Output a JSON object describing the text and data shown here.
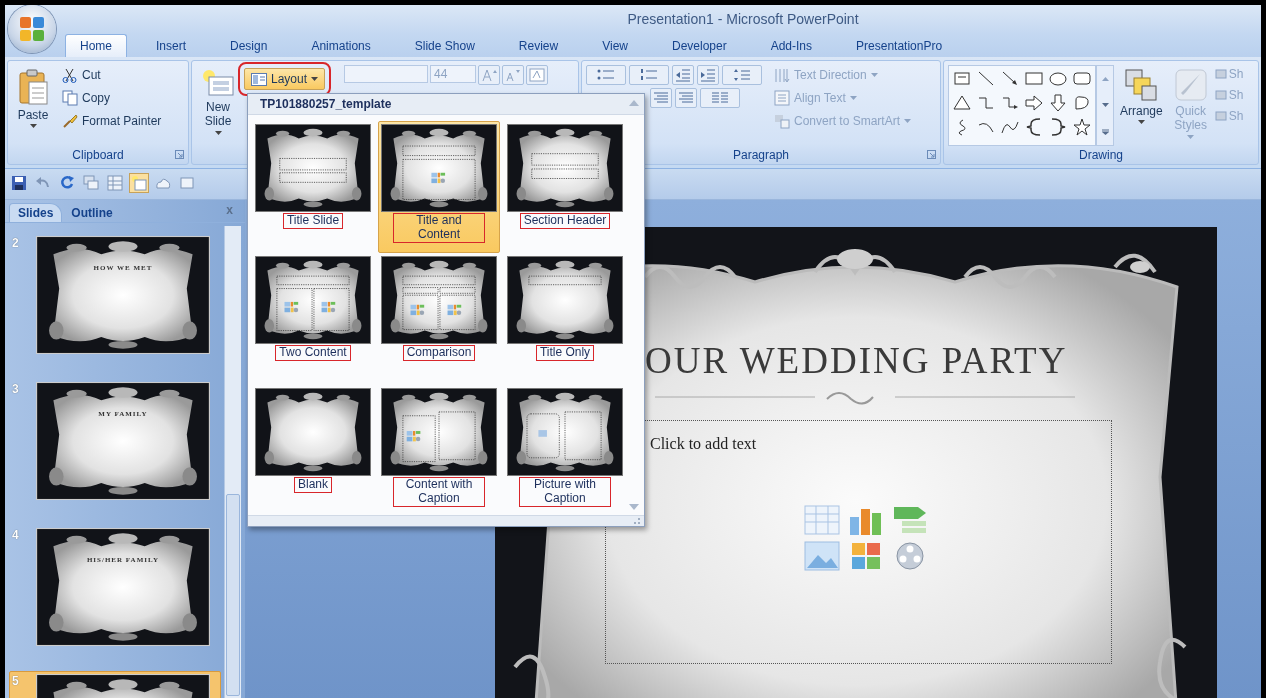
{
  "window": {
    "title": "Presentation1 - Microsoft PowerPoint"
  },
  "ribbon_tabs": [
    {
      "label": "Home",
      "selected": true
    },
    {
      "label": "Insert",
      "selected": false
    },
    {
      "label": "Design",
      "selected": false
    },
    {
      "label": "Animations",
      "selected": false
    },
    {
      "label": "Slide Show",
      "selected": false
    },
    {
      "label": "Review",
      "selected": false
    },
    {
      "label": "View",
      "selected": false
    },
    {
      "label": "Developer",
      "selected": false
    },
    {
      "label": "Add-Ins",
      "selected": false
    },
    {
      "label": "PresentationPro",
      "selected": false
    }
  ],
  "clipboard": {
    "paste": "Paste",
    "items": [
      "Cut",
      "Copy",
      "Format Painter"
    ],
    "label": "Clipboard"
  },
  "slides_group": {
    "new_slide": "New Slide",
    "layout_button": {
      "label": "Layout",
      "expanded": true
    }
  },
  "font_group": {
    "size": "44",
    "disabled": true
  },
  "paragraph": {
    "items": [
      {
        "label": "Text Direction",
        "disabled": true
      },
      {
        "label": "Align Text",
        "disabled": true
      },
      {
        "label": "Convert to SmartArt",
        "disabled": true
      }
    ],
    "label": "Paragraph"
  },
  "drawing": {
    "arrange": {
      "label": "Arrange",
      "disabled": false
    },
    "quick_styles": {
      "label": "Quick Styles",
      "disabled": true
    },
    "shape_items": [
      {
        "label": "Sh",
        "disabled": true
      },
      {
        "label": "Sh",
        "disabled": true
      },
      {
        "label": "Sh",
        "disabled": true
      }
    ],
    "label": "Drawing"
  },
  "layout_gallery": {
    "title": "TP101880257_template",
    "layouts": [
      {
        "label": "Title Slide",
        "kind": "title",
        "selected": false
      },
      {
        "label": "Title and Content",
        "kind": "title_content",
        "selected": true
      },
      {
        "label": "Section Header",
        "kind": "section",
        "selected": false
      },
      {
        "label": "Two Content",
        "kind": "two_content",
        "selected": false
      },
      {
        "label": "Comparison",
        "kind": "comparison",
        "selected": false
      },
      {
        "label": "Title Only",
        "kind": "title_only",
        "selected": false
      },
      {
        "label": "Blank",
        "kind": "blank",
        "selected": false
      },
      {
        "label": "Content with Caption",
        "kind": "content_caption",
        "selected": false
      },
      {
        "label": "Picture with Caption",
        "kind": "picture_caption",
        "selected": false
      }
    ]
  },
  "slide_pane": {
    "tabs": [
      {
        "label": "Slides",
        "selected": true
      },
      {
        "label": "Outline",
        "selected": false
      }
    ],
    "close": "x",
    "slides": [
      {
        "number": "2",
        "title": "HOW WE MET",
        "selected": false
      },
      {
        "number": "3",
        "title": "MY FAMILY",
        "selected": false
      },
      {
        "number": "4",
        "title": "HIS/HER FAMILY",
        "selected": false
      },
      {
        "number": "5",
        "selected": true
      }
    ]
  },
  "slide": {
    "title": "OUR WEDDING PARTY",
    "placeholder": "Click to add text"
  }
}
